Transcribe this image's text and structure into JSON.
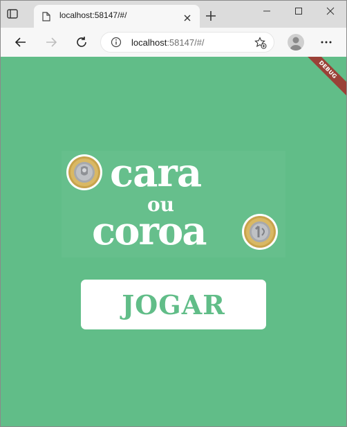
{
  "browser": {
    "tab_title": "localhost:58147/#/",
    "url_host": "localhost",
    "url_rest": ":58147/#/"
  },
  "app": {
    "debug_banner": "DEBUG",
    "logo": {
      "word_1": "cara",
      "word_2": "ou",
      "word_3": "coroa"
    },
    "play_button": "JOGAR"
  },
  "colors": {
    "background": "#61bd88",
    "button": "#ffffff",
    "debug_banner": "#9a4137"
  }
}
